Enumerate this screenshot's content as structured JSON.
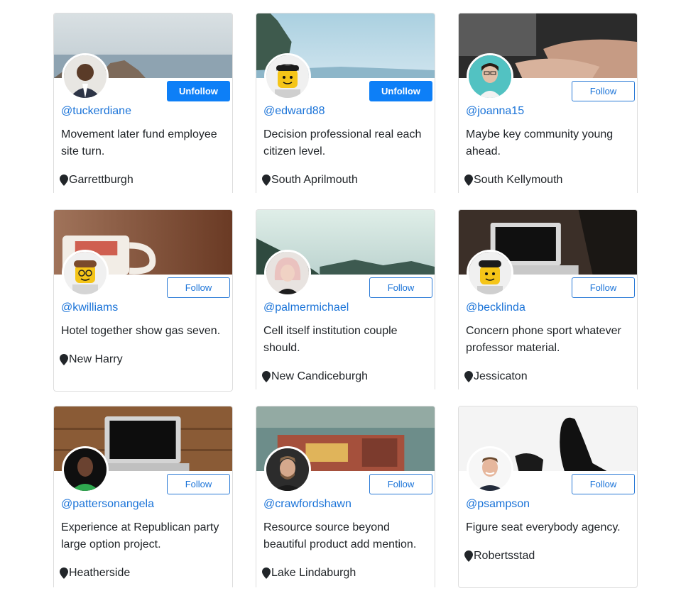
{
  "cards": [
    {
      "handle": "@tuckerdiane",
      "bio": "Movement later fund employee site turn.",
      "location": "Garrettburgh",
      "button": "Unfollow"
    },
    {
      "handle": "@edward88",
      "bio": "Decision professional real each citizen level.",
      "location": "South Aprilmouth",
      "button": "Unfollow"
    },
    {
      "handle": "@joanna15",
      "bio": "Maybe key community young ahead.",
      "location": "South Kellymouth",
      "button": "Follow"
    },
    {
      "handle": "@kwilliams",
      "bio": "Hotel together show gas seven.",
      "location": "New Harry",
      "button": "Follow"
    },
    {
      "handle": "@palmermichael",
      "bio": "Cell itself institution couple should.",
      "location": "New Candiceburgh",
      "button": "Follow"
    },
    {
      "handle": "@becklinda",
      "bio": "Concern phone sport whatever professor material.",
      "location": "Jessicaton",
      "button": "Follow"
    },
    {
      "handle": "@pattersonangela",
      "bio": "Experience at Republican party large option project.",
      "location": "Heatherside",
      "button": "Follow"
    },
    {
      "handle": "@crawfordshawn",
      "bio": "Resource source beyond beautiful product add mention.",
      "location": "Lake Lindaburgh",
      "button": "Follow"
    },
    {
      "handle": "@psampson",
      "bio": "Figure seat everybody agency.",
      "location": "Robertsstad",
      "button": "Follow"
    }
  ],
  "cover_images": [
    "sea-rocks-photo",
    "blue-mountain-landscape-photo",
    "hands-typing-laptop-photo",
    "coffee-mug-photo",
    "misty-mountain-forest-photo",
    "laptop-on-desk-photo",
    "laptop-on-wood-table-photo",
    "vintage-car-plate-photo",
    "feet-shadow-photo"
  ],
  "avatar_images": [
    "man-in-suit-photo",
    "lego-minifigure",
    "woman-with-glasses-photo",
    "lego-minifigure-glasses",
    "blonde-woman-photo",
    "lego-minifigure",
    "man-green-shirt-photo",
    "bearded-man-photo",
    "smiling-man-photo"
  ],
  "icons": {
    "location": "map-pin-icon"
  },
  "colors": {
    "link": "#1a73d8",
    "primary_button": "#0d7ff7",
    "text": "#212529"
  }
}
